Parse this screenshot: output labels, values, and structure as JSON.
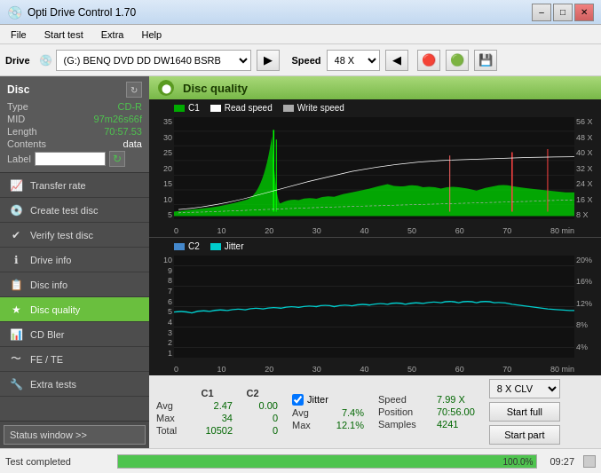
{
  "window": {
    "title": "Opti Drive Control 1.70",
    "icon": "💿"
  },
  "titlebar_controls": {
    "minimize": "–",
    "maximize": "□",
    "close": "✕"
  },
  "menu": {
    "items": [
      "File",
      "Start test",
      "Extra",
      "Help"
    ]
  },
  "toolbar": {
    "drive_label": "Drive",
    "drive_value": "(G:)  BENQ DVD DD DW1640 BSRB",
    "speed_label": "Speed",
    "speed_value": "48 X",
    "refresh_icon": "▶",
    "eject_icon": "⏏",
    "settings_icon": "⚙",
    "save_icon": "💾"
  },
  "disc_panel": {
    "title": "Disc",
    "refresh": "↻",
    "fields": {
      "type_label": "Type",
      "type_value": "CD-R",
      "mid_label": "MID",
      "mid_value": "97m26s66f",
      "length_label": "Length",
      "length_value": "70:57.53",
      "contents_label": "Contents",
      "contents_value": "data",
      "label_label": "Label",
      "label_value": ""
    }
  },
  "sidebar": {
    "items": [
      {
        "id": "transfer-rate",
        "icon": "📈",
        "label": "Transfer rate",
        "active": false
      },
      {
        "id": "create-test-disc",
        "icon": "💿",
        "label": "Create test disc",
        "active": false
      },
      {
        "id": "verify-test-disc",
        "icon": "✔",
        "label": "Verify test disc",
        "active": false
      },
      {
        "id": "drive-info",
        "icon": "ℹ",
        "label": "Drive info",
        "active": false
      },
      {
        "id": "disc-info",
        "icon": "📋",
        "label": "Disc info",
        "active": false
      },
      {
        "id": "disc-quality",
        "icon": "★",
        "label": "Disc quality",
        "active": true
      },
      {
        "id": "cd-bler",
        "icon": "📊",
        "label": "CD Bler",
        "active": false
      },
      {
        "id": "fe-te",
        "icon": "〜",
        "label": "FE / TE",
        "active": false
      },
      {
        "id": "extra-tests",
        "icon": "🔧",
        "label": "Extra tests",
        "active": false
      }
    ],
    "status_window": "Status window >>"
  },
  "disc_quality": {
    "title": "Disc quality",
    "legend": {
      "c1": "C1",
      "read_speed": "Read speed",
      "write_speed": "Write speed"
    },
    "chart1": {
      "y_left": [
        "35",
        "30",
        "25",
        "20",
        "15",
        "10",
        "5"
      ],
      "y_right": [
        "56 X",
        "48 X",
        "40 X",
        "32 X",
        "24 X",
        "16 X",
        "8 X"
      ],
      "x": [
        "0",
        "10",
        "20",
        "30",
        "40",
        "50",
        "60",
        "70",
        "80 min"
      ]
    },
    "chart2": {
      "title": "C2",
      "jitter": "Jitter",
      "y_left": [
        "10",
        "9",
        "8",
        "7",
        "6",
        "5",
        "4",
        "3",
        "2",
        "1"
      ],
      "y_right": [
        "20%",
        "16%",
        "12%",
        "8%",
        "4%"
      ],
      "x": [
        "0",
        "10",
        "20",
        "30",
        "40",
        "50",
        "60",
        "70",
        "80 min"
      ]
    }
  },
  "stats": {
    "headers": [
      "C1",
      "C2"
    ],
    "rows": [
      {
        "label": "Avg",
        "c1": "2.47",
        "c2": "0.00"
      },
      {
        "label": "Max",
        "c1": "34",
        "c2": "0"
      },
      {
        "label": "Total",
        "c1": "10502",
        "c2": "0"
      }
    ],
    "jitter_checked": true,
    "jitter_label": "Jitter",
    "jitter_avg": "7.4%",
    "jitter_max": "12.1%",
    "jitter_total": "",
    "speed_label": "Speed",
    "speed_value": "7.99 X",
    "position_label": "Position",
    "position_value": "70:56.00",
    "samples_label": "Samples",
    "samples_value": "4241",
    "speed_combo": "8 X CLV",
    "start_full_btn": "Start full",
    "start_part_btn": "Start part"
  },
  "statusbar": {
    "text": "Test completed",
    "progress": 100,
    "progress_text": "100.0%",
    "time": "09:27"
  },
  "colors": {
    "green_accent": "#4fc44f",
    "dark_bg": "#1a1a1a",
    "sidebar_bg": "#4d4d4d",
    "active_item": "#6abf3e"
  }
}
